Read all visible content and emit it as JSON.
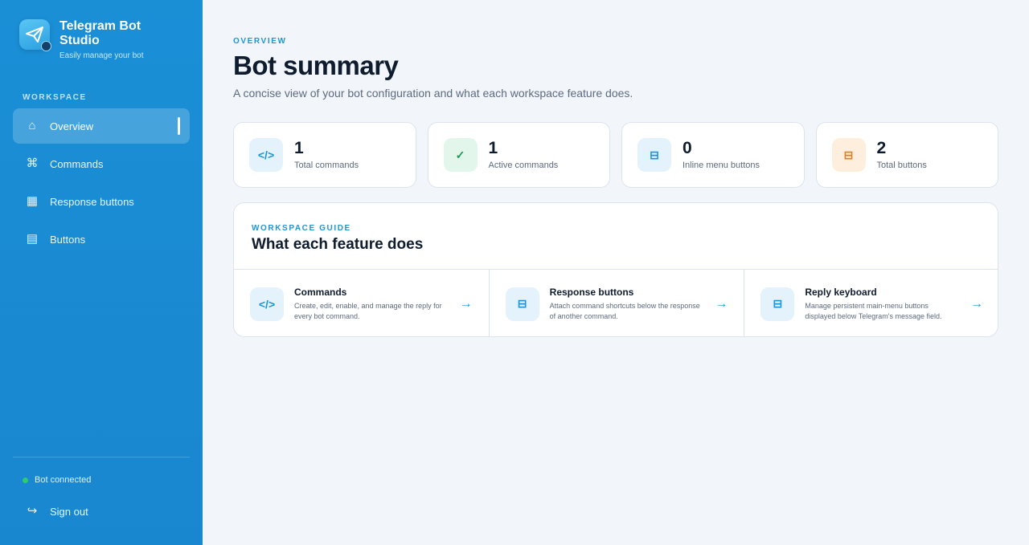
{
  "brand": {
    "title": "Telegram Bot Studio",
    "subtitle": "Easily manage your bot"
  },
  "sidebar": {
    "section_label": "WORKSPACE",
    "items": [
      {
        "label": "Overview",
        "icon": "home-icon",
        "active": true
      },
      {
        "label": "Commands",
        "icon": "command-icon",
        "active": false
      },
      {
        "label": "Response buttons",
        "icon": "grid-icon",
        "active": false
      },
      {
        "label": "Buttons",
        "icon": "list-icon",
        "active": false
      }
    ],
    "status": "Bot connected",
    "status_color": "#2ecc71",
    "signout": "Sign out"
  },
  "header": {
    "eyebrow": "OVERVIEW",
    "title": "Bot summary",
    "subtitle": "A concise view of your bot configuration and what each workspace feature does."
  },
  "stats": [
    {
      "value": "1",
      "label": "Total commands",
      "icon": "code-icon"
    },
    {
      "value": "1",
      "label": "Active commands",
      "icon": "check-icon"
    },
    {
      "value": "0",
      "label": "Inline menu buttons",
      "icon": "keyboard-icon"
    },
    {
      "value": "2",
      "label": "Total buttons",
      "icon": "keyboard-icon"
    }
  ],
  "guide": {
    "eyebrow": "WORKSPACE GUIDE",
    "title": "What each feature does",
    "features": [
      {
        "title": "Commands",
        "desc": "Create, edit, enable, and manage the reply for every bot command.",
        "icon": "code-icon"
      },
      {
        "title": "Response buttons",
        "desc": "Attach command shortcuts below the response of another command.",
        "icon": "keyboard-icon"
      },
      {
        "title": "Reply keyboard",
        "desc": "Manage persistent main-menu buttons displayed below Telegram's message field.",
        "icon": "keyboard-icon"
      }
    ]
  },
  "colors": {
    "accent": "#1f95d6",
    "sidebar": "#1a8fd6",
    "background": "#f2f6fb"
  }
}
